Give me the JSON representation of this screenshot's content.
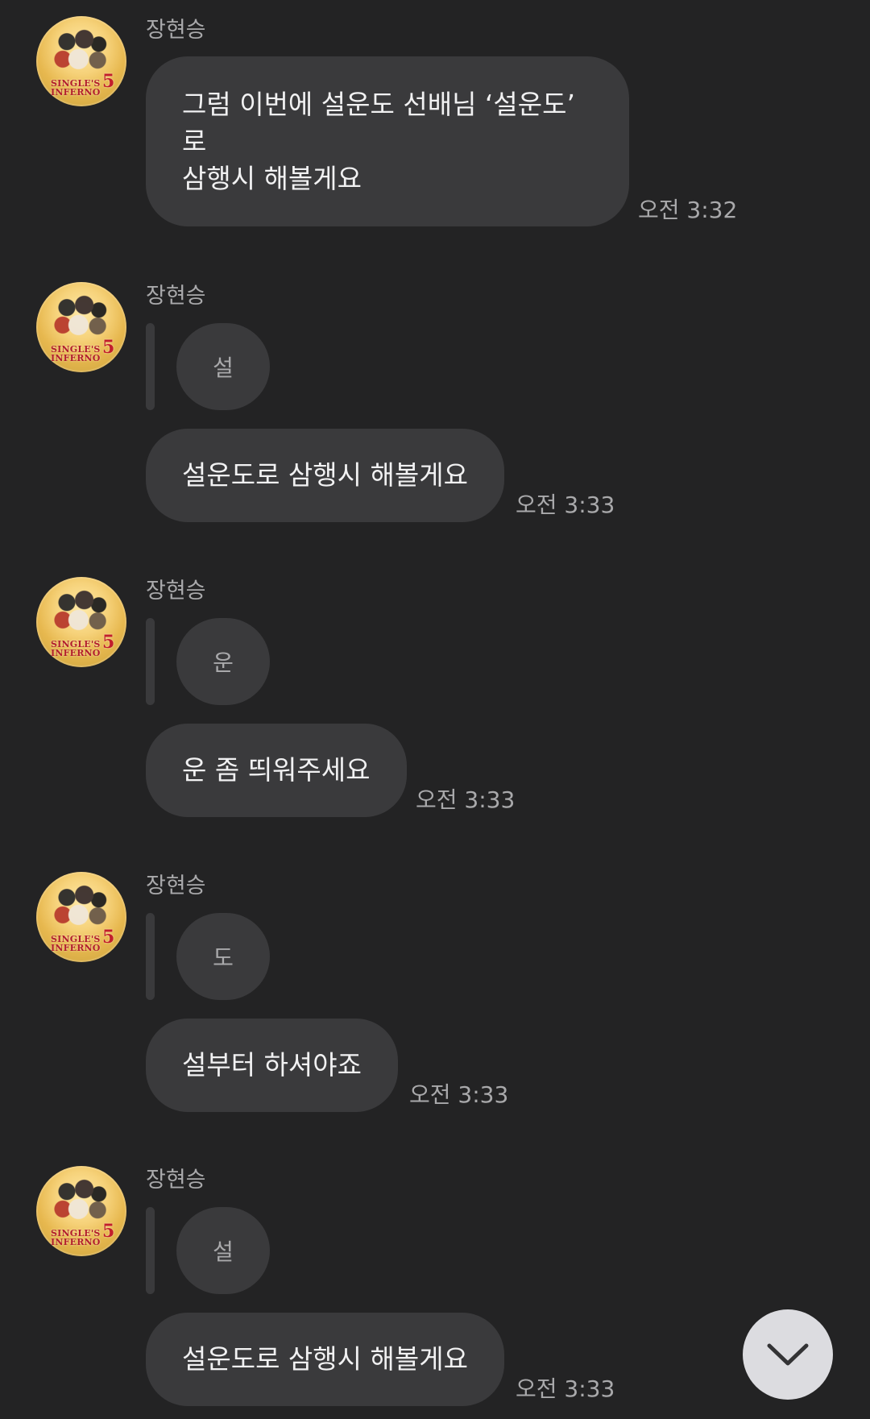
{
  "messages": [
    {
      "sender": "장현승",
      "lines": [
        "그럼 이번에 설운도 선배님 ‘설운도’",
        "로",
        "삼행시 해볼게요"
      ],
      "time": "오전 3:32"
    },
    {
      "sender": "장현승",
      "quote": "설",
      "text": "설운도로 삼행시 해볼게요",
      "time": "오전 3:33"
    },
    {
      "sender": "장현승",
      "quote": "운",
      "text": "운 좀 띄워주세요",
      "time": "오전 3:33"
    },
    {
      "sender": "장현승",
      "quote": "도",
      "text": "설부터 하셔야죠",
      "time": "오전 3:33"
    },
    {
      "sender": "장현승",
      "quote": "설",
      "text": "설운도로 삼행시 해볼게요",
      "time": "오전 3:33"
    }
  ],
  "avatar": {
    "logo_text_1": "SINGLE'S",
    "logo_text_2": "INFERNO",
    "logo_number": "5"
  },
  "scroll_button": {
    "icon": "chevron-down-icon"
  },
  "colors": {
    "background": "#232324",
    "bubble": "#3a3a3c",
    "text": "#f1f1f2",
    "meta_text": "#a9a9ab",
    "scroll_button": "#dcdce0"
  }
}
